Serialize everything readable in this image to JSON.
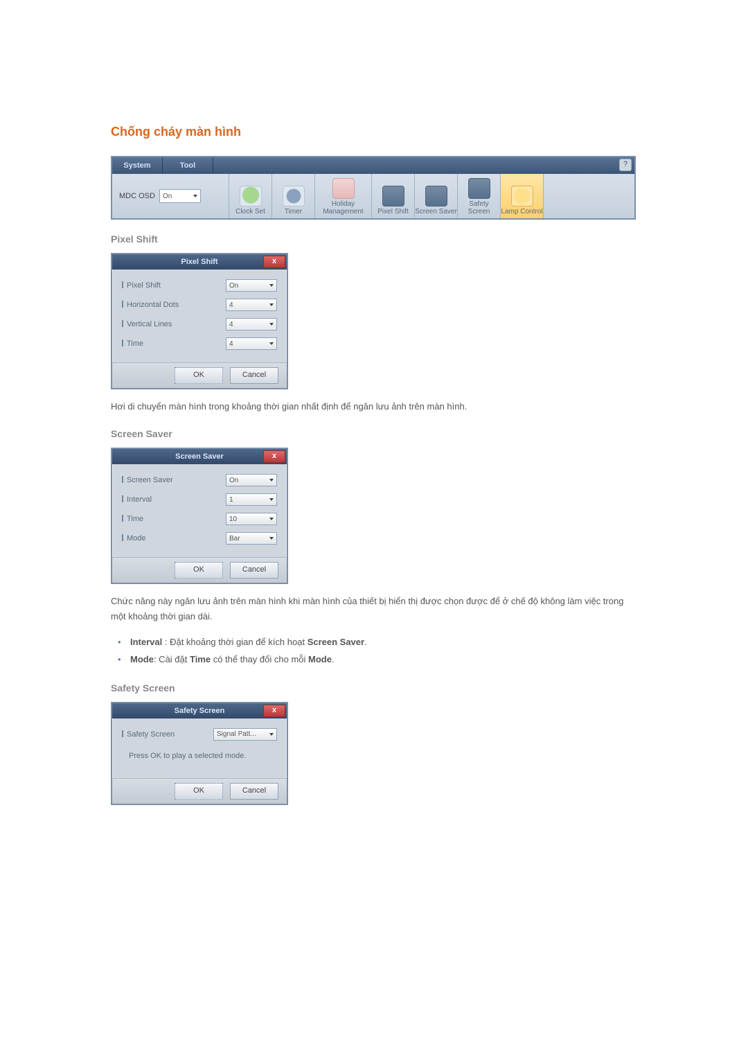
{
  "title": "Chống cháy màn hình",
  "toolbar": {
    "tabs": [
      "System",
      "Tool"
    ],
    "help": "?",
    "mdc": {
      "label": "MDC OSD",
      "value": "On"
    },
    "items": [
      {
        "label": "Clock Set"
      },
      {
        "label": "Timer"
      },
      {
        "label": "Holiday Management"
      },
      {
        "label": "Pixel Shift"
      },
      {
        "label": "Screen Saver"
      },
      {
        "label": "Safety Screen"
      },
      {
        "label": "Lamp Control"
      }
    ]
  },
  "pixelShift": {
    "heading": "Pixel Shift",
    "dialogTitle": "Pixel Shift",
    "rows": [
      {
        "label": "Pixel Shift",
        "value": "On"
      },
      {
        "label": "Horizontal Dots",
        "value": "4"
      },
      {
        "label": "Vertical Lines",
        "value": "4"
      },
      {
        "label": "Time",
        "value": "4"
      }
    ],
    "ok": "OK",
    "cancel": "Cancel",
    "desc": "Hơi di chuyển màn hình trong khoảng thời gian nhất định để ngăn lưu ảnh trên màn hình."
  },
  "screenSaver": {
    "heading": "Screen Saver",
    "dialogTitle": "Screen Saver",
    "rows": [
      {
        "label": "Screen Saver",
        "value": "On"
      },
      {
        "label": "Interval",
        "value": "1"
      },
      {
        "label": "Time",
        "value": "10"
      },
      {
        "label": "Mode",
        "value": "Bar"
      }
    ],
    "ok": "OK",
    "cancel": "Cancel",
    "desc": "Chức năng này ngăn lưu ảnh trên màn hình khi màn hình của thiết bị hiển thị được chọn được để ở chế độ không làm việc trong một khoảng thời gian dài.",
    "bullets": {
      "interval_term": "Interval",
      "interval_text": " : Đặt khoảng thời gian để kích hoạt ",
      "interval_term2": "Screen Saver",
      "interval_end": ".",
      "mode_term": "Mode",
      "mode_text": ": Cài đặt ",
      "mode_time": "Time",
      "mode_text2": " có thể thay đổi cho mỗi ",
      "mode_term2": "Mode",
      "mode_end": "."
    }
  },
  "safetyScreen": {
    "heading": "Safety Screen",
    "dialogTitle": "Safety Screen",
    "rows": [
      {
        "label": "Safety Screen",
        "value": "Signal Patt..."
      }
    ],
    "hint": "Press OK to play a selected mode.",
    "ok": "OK",
    "cancel": "Cancel"
  },
  "close": "x"
}
